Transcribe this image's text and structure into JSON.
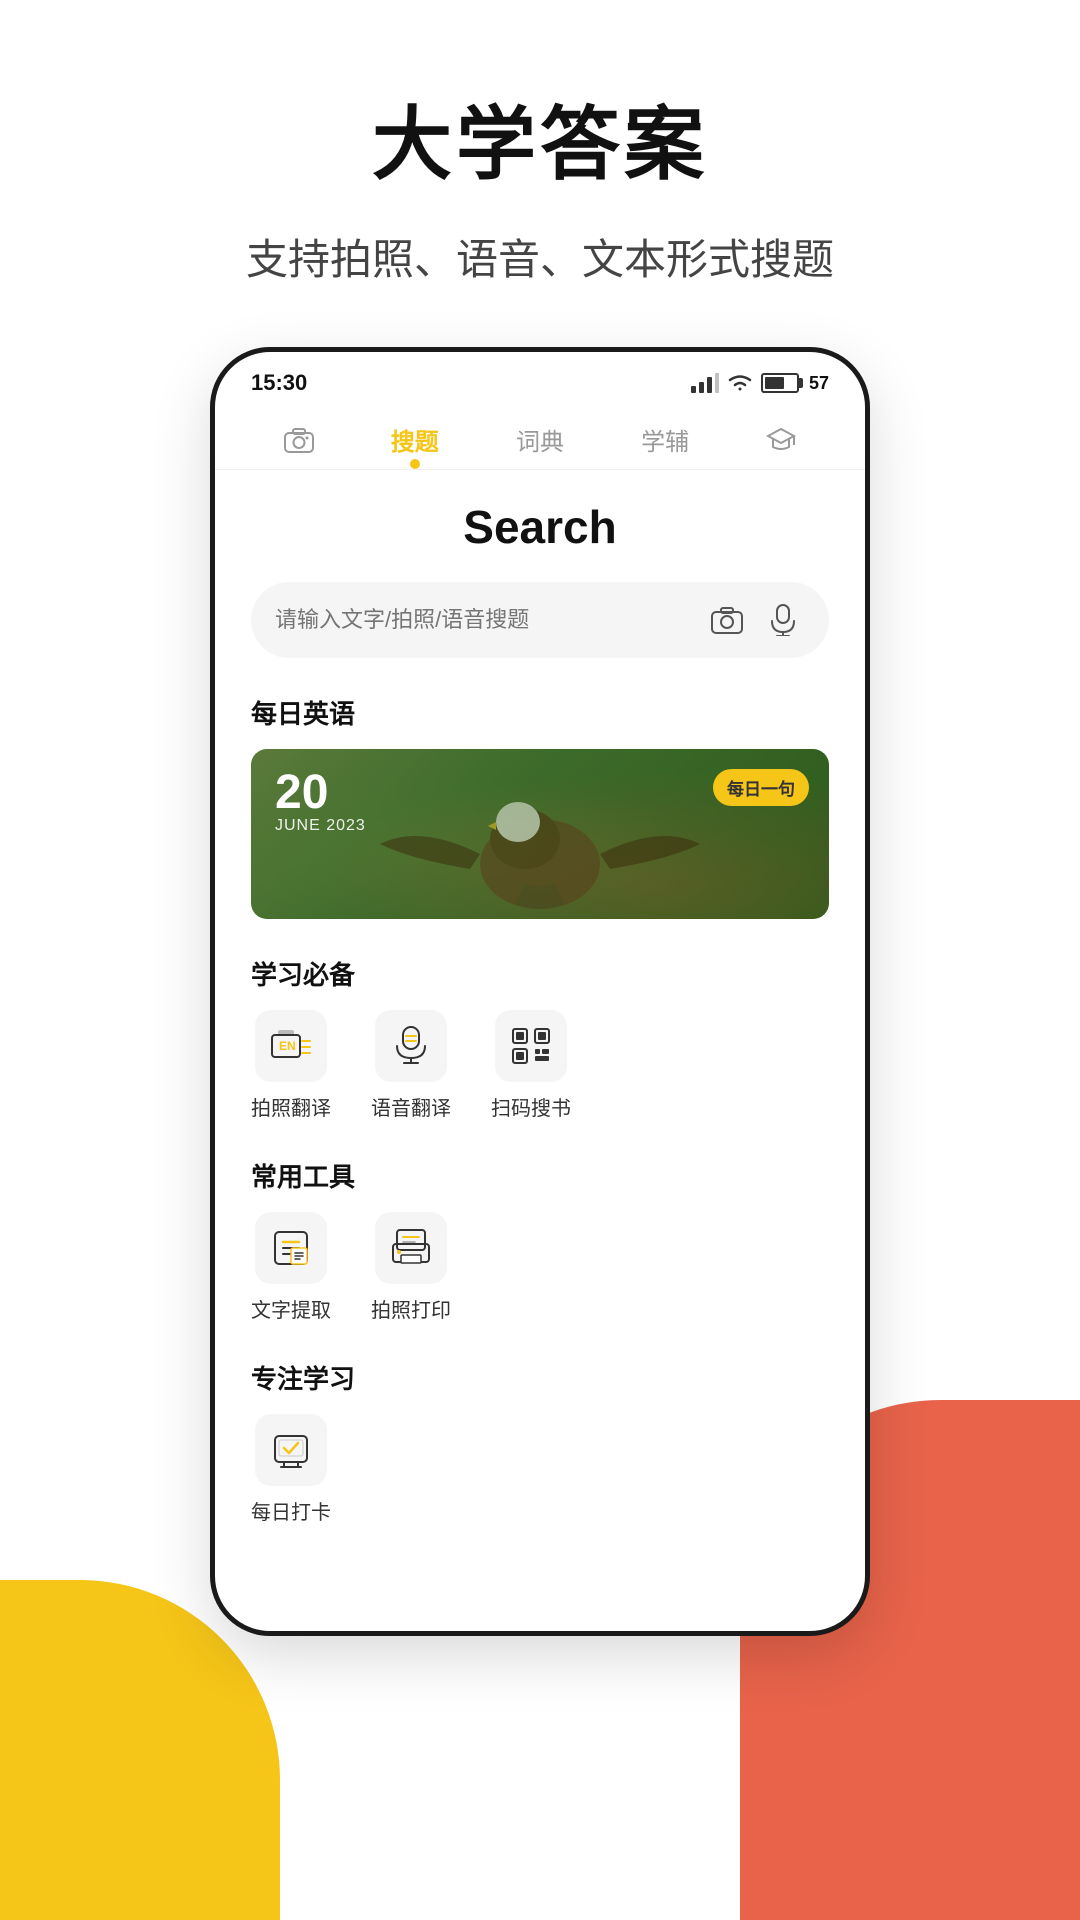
{
  "page": {
    "title": "大学答案",
    "subtitle": "支持拍照、语音、文本形式搜题"
  },
  "status_bar": {
    "time": "15:30",
    "battery": "57"
  },
  "nav": {
    "tabs": [
      {
        "id": "camera",
        "label": "",
        "icon": "camera",
        "active": false
      },
      {
        "id": "search",
        "label": "搜题",
        "active": true
      },
      {
        "id": "dict",
        "label": "词典",
        "active": false
      },
      {
        "id": "tutor",
        "label": "学辅",
        "active": false
      },
      {
        "id": "graduation",
        "label": "",
        "icon": "graduation",
        "active": false
      }
    ]
  },
  "search_section": {
    "heading": "Search",
    "search_placeholder": "请输入文字/拍照/语音搜题"
  },
  "daily_english": {
    "section_title": "每日英语",
    "banner": {
      "day": "20",
      "month_year": "JUNE  2023",
      "tag": "每日一句"
    }
  },
  "study_tools": {
    "section_title": "学习必备",
    "items": [
      {
        "label": "拍照翻译",
        "icon": "photo-translate"
      },
      {
        "label": "语音翻译",
        "icon": "voice-translate"
      },
      {
        "label": "扫码搜书",
        "icon": "scan-book"
      }
    ]
  },
  "common_tools": {
    "section_title": "常用工具",
    "items": [
      {
        "label": "文字提取",
        "icon": "text-extract"
      },
      {
        "label": "拍照打印",
        "icon": "photo-print"
      }
    ]
  },
  "focus_study": {
    "section_title": "专注学习",
    "items": [
      {
        "label": "每日打卡",
        "icon": "daily-checkin"
      }
    ]
  },
  "colors": {
    "accent": "#F5C518",
    "accent_red": "#E8634A",
    "text_primary": "#111111",
    "text_secondary": "#999999"
  }
}
